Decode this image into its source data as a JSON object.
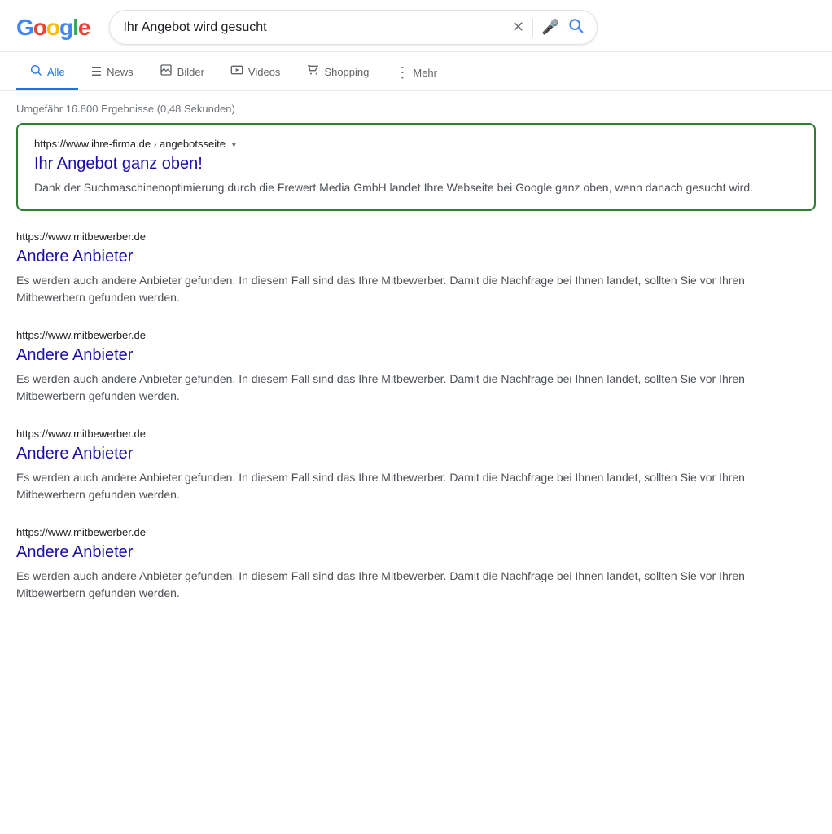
{
  "header": {
    "logo_letters": [
      {
        "letter": "G",
        "color": "g-blue"
      },
      {
        "letter": "o",
        "color": "g-red"
      },
      {
        "letter": "o",
        "color": "g-yellow"
      },
      {
        "letter": "g",
        "color": "g-blue"
      },
      {
        "letter": "l",
        "color": "g-green"
      },
      {
        "letter": "e",
        "color": "g-red"
      }
    ],
    "search_query": "Ihr Angebot wird gesucht"
  },
  "nav": {
    "tabs": [
      {
        "label": "Alle",
        "active": true,
        "icon": "🔍"
      },
      {
        "label": "News",
        "active": false,
        "icon": "☰"
      },
      {
        "label": "Bilder",
        "active": false,
        "icon": "🖼"
      },
      {
        "label": "Videos",
        "active": false,
        "icon": "▶"
      },
      {
        "label": "Shopping",
        "active": false,
        "icon": "🏷"
      },
      {
        "label": "Mehr",
        "active": false,
        "icon": "⋮"
      }
    ]
  },
  "results_stats": "Umgefähr 16.800 Ergebnisse (0,48 Sekunden)",
  "featured": {
    "url": "https://www.ihre-firma.de",
    "breadcrumb": "angebotsseite",
    "title": "Ihr Angebot ganz oben!",
    "snippet": "Dank der Suchmaschinenoptimierung durch die Frewert Media GmbH landet Ihre Webseite bei Google ganz oben, wenn danach gesucht wird."
  },
  "results": [
    {
      "url": "https://www.mitbewerber.de",
      "title": "Andere Anbieter",
      "snippet": "Es werden auch andere Anbieter gefunden. In diesem Fall sind das Ihre Mitbewerber. Damit die Nachfrage bei Ihnen landet, sollten Sie vor Ihren Mitbewerbern gefunden werden."
    },
    {
      "url": "https://www.mitbewerber.de",
      "title": "Andere Anbieter",
      "snippet": "Es werden auch andere Anbieter gefunden. In diesem Fall sind das Ihre Mitbewerber. Damit die Nachfrage bei Ihnen landet, sollten Sie vor Ihren Mitbewerbern gefunden werden."
    },
    {
      "url": "https://www.mitbewerber.de",
      "title": "Andere Anbieter",
      "snippet": "Es werden auch andere Anbieter gefunden. In diesem Fall sind das Ihre Mitbewerber. Damit die Nachfrage bei Ihnen landet, sollten Sie vor Ihren Mitbewerbern gefunden werden."
    },
    {
      "url": "https://www.mitbewerber.de",
      "title": "Andere Anbieter",
      "snippet": "Es werden auch andere Anbieter gefunden. In diesem Fall sind das Ihre Mitbewerber. Damit die Nachfrage bei Ihnen landet, sollten Sie vor Ihren Mitbewerbern gefunden werden."
    }
  ],
  "icons": {
    "clear": "✕",
    "mic": "🎤",
    "search": "🔍",
    "dropdown": "▾"
  }
}
